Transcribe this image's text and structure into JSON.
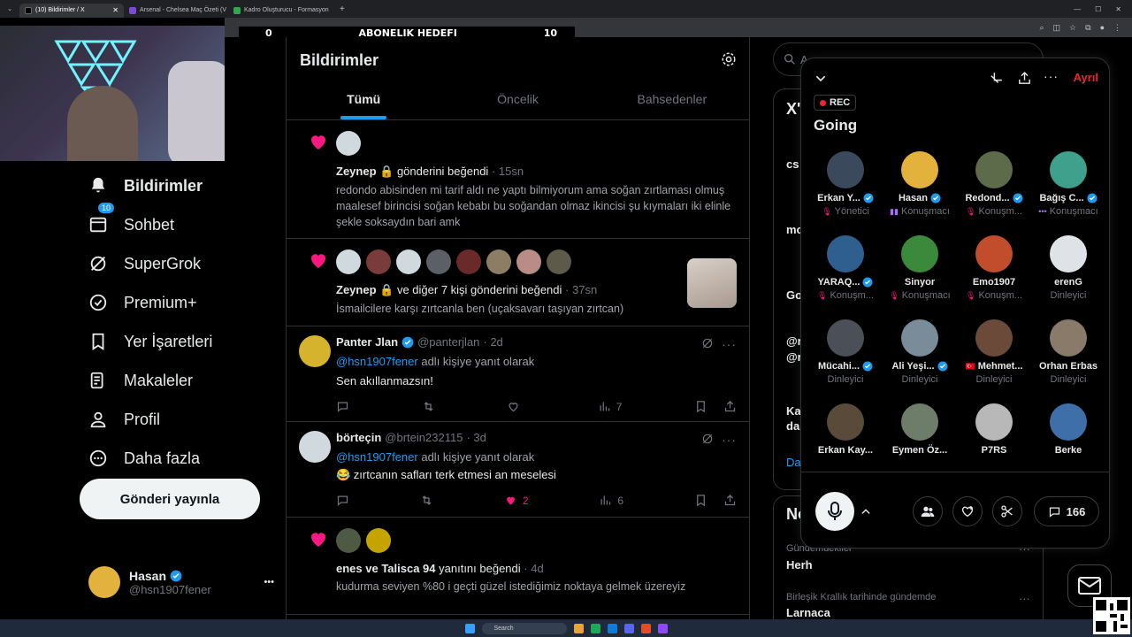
{
  "browser": {
    "tabs": [
      {
        "title": "(10) Bildirimler / X",
        "active": true,
        "color": "#000000"
      },
      {
        "title": "Arsenal - Chelsea Maç Özeti (V",
        "active": false,
        "color": "#7b4ad6"
      },
      {
        "title": "Kadro Oluşturucu - Formasyon",
        "active": false,
        "color": "#2fa84f"
      }
    ],
    "new_tab": "+"
  },
  "stream_overlay": {
    "left": "0",
    "center": "ABONELIK HEDEFI",
    "right": "10"
  },
  "nav": {
    "items": [
      {
        "label": "Bildirimler",
        "icon": "bell-icon",
        "active": true
      },
      {
        "label": "Sohbet",
        "icon": "chat-icon",
        "badge": "10"
      },
      {
        "label": "SuperGrok",
        "icon": "grok-icon"
      },
      {
        "label": "Premium+",
        "icon": "premium-icon"
      },
      {
        "label": "Yer İşaretleri",
        "icon": "bookmark-icon"
      },
      {
        "label": "Makaleler",
        "icon": "article-icon"
      },
      {
        "label": "Profil",
        "icon": "profile-icon"
      },
      {
        "label": "Daha fazla",
        "icon": "more-circle-icon"
      }
    ],
    "post_button": "Gönderi yayınla"
  },
  "account": {
    "name": "Hasan",
    "handle": "@hsn1907fener",
    "more": "•••"
  },
  "feed": {
    "title": "Bildirimler",
    "tabs": [
      "Tümü",
      "Öncelik",
      "Bahsedenler"
    ],
    "notifications": [
      {
        "user": "Zeynep",
        "action": "gönderini beğendi",
        "time": "· 15sn",
        "body": "redondo abisinden mi tarif aldı ne yaptı bilmiyorum ama soğan zırtlaması olmuş maalesef birincisi soğan kebabı bu soğandan olmaz  ikincisi şu kıymaları iki elinle şekle soksaydın bari amk"
      },
      {
        "user": "Zeynep",
        "action": "ve diğer 7 kişi gönderini beğendi",
        "time": "· 37sn",
        "body": "İsmailcilere karşı zırtcanla ben (uçaksavarı taşıyan zırtcan)"
      }
    ],
    "replies": [
      {
        "name": "Panter Jlan",
        "handle": "@panterjlan",
        "time": "· 2d",
        "reply_prefix": "@hsn1907fener",
        "reply_suffix": "adlı kişiye yanıt olarak",
        "text": "Sen akıllanmazsın!",
        "likes": "",
        "views": "7"
      },
      {
        "name": "börteçin",
        "handle": "@brtein232115",
        "time": "· 3d",
        "reply_prefix": "@hsn1907fener",
        "reply_suffix": "adlı kişiye yanıt olarak",
        "text": "😂 zırtcanın safları terk etmesi an meselesi",
        "likes": "2",
        "views": "6"
      }
    ],
    "last": {
      "users": "enes ve Talisca 94",
      "action": "yanıtını beğendi",
      "time": "· 4d",
      "body": "kudurma seviyen %80 i geçti güzel istediğimiz noktaya gelmek üzereyiz"
    }
  },
  "right": {
    "search_placeholder": "A",
    "fragments": [
      "X'",
      "cs",
      "mo",
      "Go",
      "@r",
      "@r",
      "Ka",
      "da",
      "Da",
      "No"
    ],
    "trends": [
      {
        "context": "Gündemdekiler",
        "name": "Herh"
      },
      {
        "context": "Birleşik Krallık tarihinde gündemde",
        "name": "Larnaca"
      }
    ]
  },
  "space": {
    "leave": "Ayrıl",
    "rec": "REC",
    "title": "Going",
    "members": [
      {
        "name": "Erkan Y...",
        "role": "Yönetici",
        "verified": true,
        "mic": "muted"
      },
      {
        "name": "Hasan",
        "role": "Konuşmacı",
        "verified": true,
        "mic": "talking"
      },
      {
        "name": "Redond...",
        "role": "Konuşm...",
        "verified": true,
        "mic": "muted"
      },
      {
        "name": "Bağış C...",
        "role": "Konuşmacı",
        "verified": true,
        "mic": "dots"
      },
      {
        "name": "YARAQ...",
        "role": "Konuşm...",
        "verified": true,
        "mic": "muted"
      },
      {
        "name": "Sinyor",
        "role": "Konuşmacı",
        "verified": false,
        "mic": "muted"
      },
      {
        "name": "Emo1907",
        "role": "Konuşm...",
        "verified": false,
        "mic": "muted"
      },
      {
        "name": "erenG",
        "role": "Dinleyici",
        "verified": false,
        "mic": ""
      },
      {
        "name": "Mücahi...",
        "role": "Dinleyici",
        "verified": true,
        "mic": ""
      },
      {
        "name": "Ali Yeşi...",
        "role": "Dinleyici",
        "verified": true,
        "mic": ""
      },
      {
        "name": "Mehmet...",
        "role": "Dinleyici",
        "verified": false,
        "mic": "",
        "flag": true
      },
      {
        "name": "Orhan Erbas",
        "role": "Dinleyici",
        "verified": false,
        "mic": ""
      },
      {
        "name": "Erkan Kay...",
        "role": "",
        "verified": false,
        "mic": ""
      },
      {
        "name": "Eymen Öz...",
        "role": "",
        "verified": false,
        "mic": ""
      },
      {
        "name": "P7RS",
        "role": "",
        "verified": false,
        "mic": ""
      },
      {
        "name": "Berke",
        "role": "",
        "verified": false,
        "mic": ""
      }
    ],
    "comment_count": "166"
  },
  "taskbar": {
    "search": "Search"
  },
  "colors": {
    "accent": "#1d9bf0",
    "like": "#f91880",
    "leave": "#f4212e"
  }
}
